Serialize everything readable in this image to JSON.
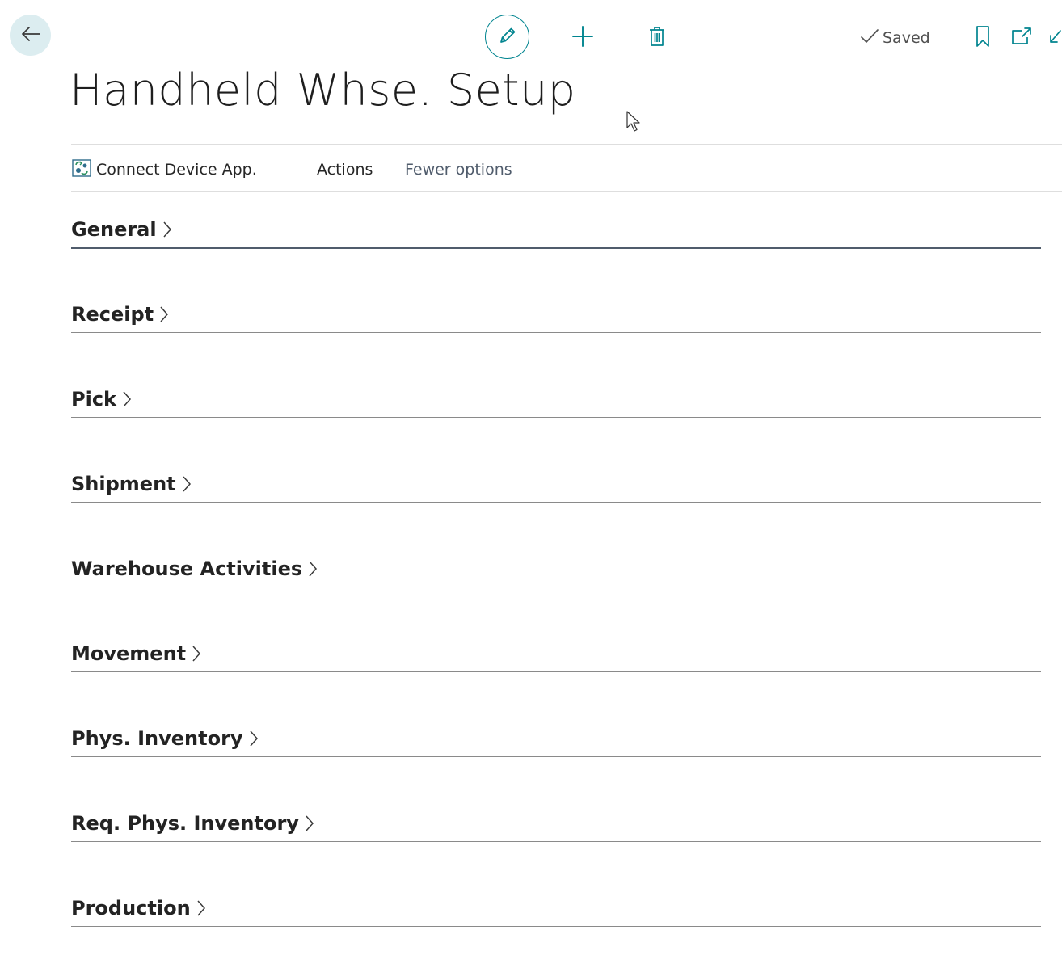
{
  "toolbar": {
    "back_icon": "arrow-left-icon",
    "edit_icon": "pencil-icon",
    "new_icon": "plus-icon",
    "delete_icon": "trash-icon",
    "saved_label": "Saved",
    "bookmark_icon": "bookmark-icon",
    "open_new_window_icon": "open-new-window-icon",
    "collapse_icon": "collapse-icon"
  },
  "page": {
    "title": "Handheld Whse. Setup"
  },
  "action_bar": {
    "connect_device_label": "Connect Device App.",
    "actions_label": "Actions",
    "fewer_options_label": "Fewer options"
  },
  "sections": [
    {
      "label": "General",
      "active": true
    },
    {
      "label": "Receipt"
    },
    {
      "label": "Pick"
    },
    {
      "label": "Shipment"
    },
    {
      "label": "Warehouse Activities"
    },
    {
      "label": "Movement"
    },
    {
      "label": "Phys. Inventory"
    },
    {
      "label": "Req. Phys. Inventory"
    },
    {
      "label": "Production"
    }
  ],
  "colors": {
    "accent": "#00848f",
    "back_button_bg": "#dcedf0",
    "active_section_underline": "#505c6c"
  }
}
